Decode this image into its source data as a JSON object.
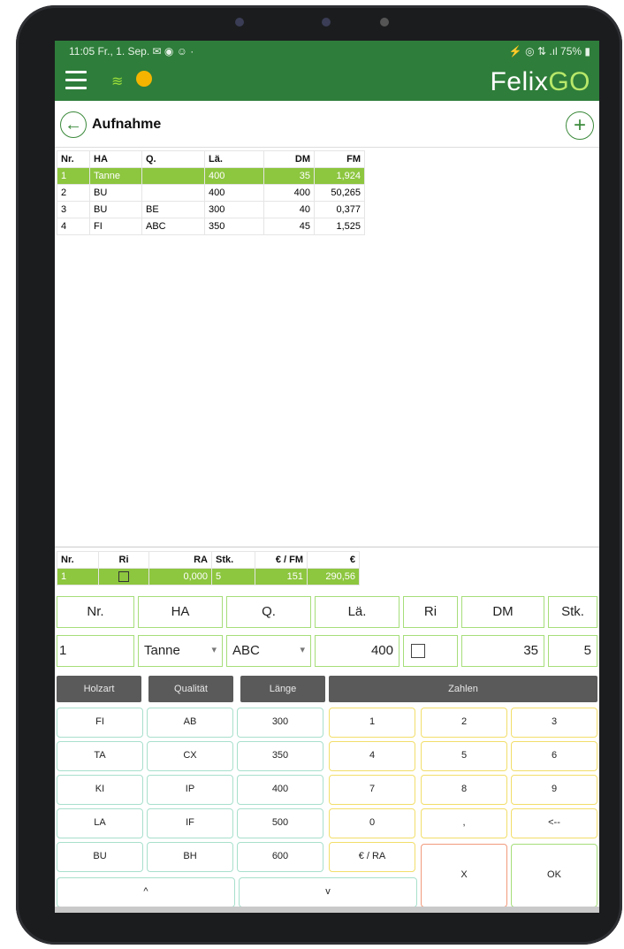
{
  "status_bar": {
    "time": "11:05 Fr., 1. Sep. ✉ ◉ ☺ ·",
    "right": "⚡ ◎ ⇅ .ıl 75% ▮"
  },
  "app_bar": {
    "brand_felix": "Felix",
    "brand_go": "GO"
  },
  "page": {
    "title": "Aufnahme",
    "back": "←",
    "add": "+"
  },
  "main_table": {
    "headers": [
      "Nr.",
      "HA",
      "Q.",
      "Lä.",
      "DM",
      "FM"
    ],
    "rows": [
      [
        "1",
        "Tanne",
        "",
        "400",
        "35",
        "1,924"
      ],
      [
        "2",
        "BU",
        "",
        "400",
        "400",
        "50,265"
      ],
      [
        "3",
        "BU",
        "BE",
        "300",
        "40",
        "0,377"
      ],
      [
        "4",
        "FI",
        "ABC",
        "350",
        "45",
        "1,525"
      ]
    ],
    "selected_row": 0
  },
  "summary_table": {
    "headers": [
      "Nr.",
      "Ri",
      "RA",
      "Stk.",
      "€ / FM",
      "€"
    ],
    "row": [
      "1",
      "",
      "0,000",
      "5",
      "151",
      "290,56"
    ]
  },
  "input_labels": {
    "nr": "Nr.",
    "ha": "HA",
    "q": "Q.",
    "la": "Lä.",
    "ri": "Ri",
    "dm": "DM",
    "stk": "Stk."
  },
  "input_values": {
    "nr": "1",
    "ha": "Tanne",
    "q": "ABC",
    "la": "400",
    "dm": "35",
    "stk": "5"
  },
  "dropdown_arrow": "▾",
  "tabs": [
    "Holzart",
    "Qualität",
    "Länge",
    "Zahlen"
  ],
  "keys": {
    "holzart": [
      "FI",
      "TA",
      "KI",
      "LA",
      "BU"
    ],
    "qualitaet": [
      "AB",
      "CX",
      "IP",
      "IF",
      "BH"
    ],
    "laenge": [
      "300",
      "350",
      "400",
      "500",
      "600"
    ],
    "zahlen_col1": [
      "1",
      "4",
      "7",
      "0",
      "€ / RA"
    ],
    "zahlen_col2": [
      "2",
      "5",
      "8",
      ","
    ],
    "zahlen_col3": [
      "3",
      "6",
      "9",
      "<--"
    ],
    "up": "^",
    "down": "v",
    "x": "X",
    "ok": "OK"
  },
  "colors": {
    "header_green": "#2e7d3a",
    "selected_row": "#8dc63f",
    "accent": "#b8e86a"
  }
}
